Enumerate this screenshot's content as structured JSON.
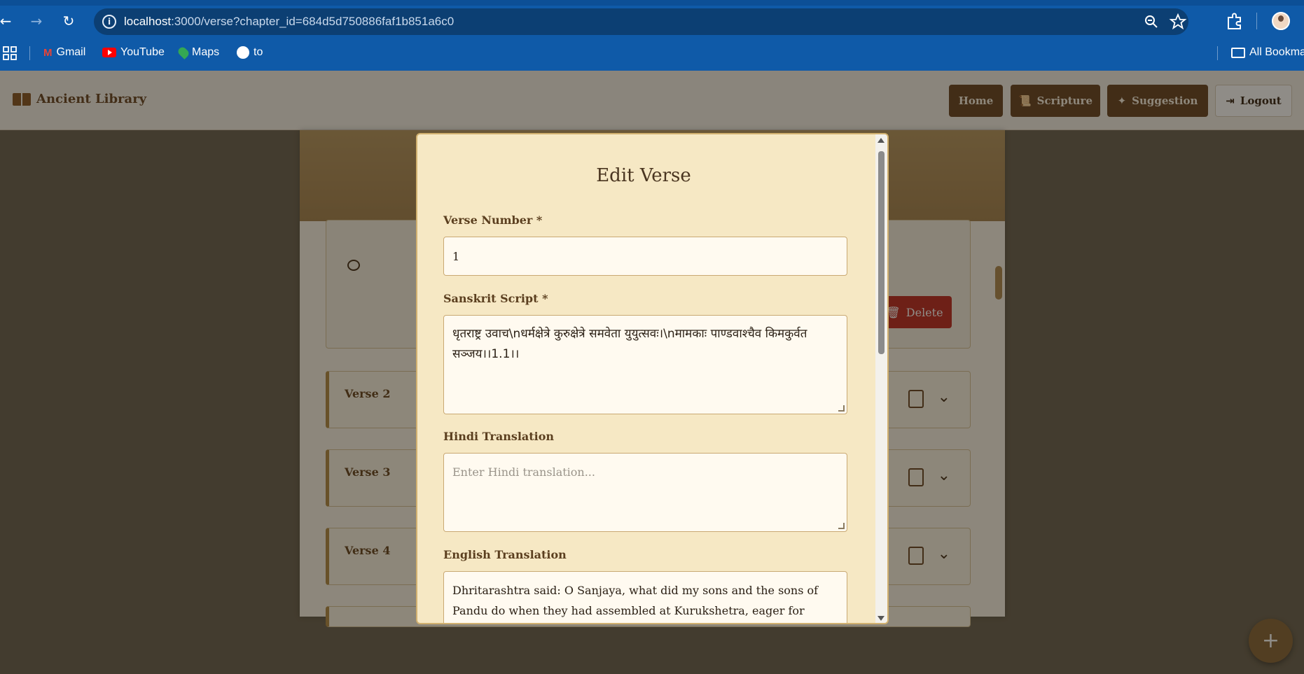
{
  "browser": {
    "url_host": "localhost",
    "url_rest": ":3000/verse?chapter_id=684d5d750886faf1b851a6c0",
    "bookmarks": [
      "Gmail",
      "YouTube",
      "Maps",
      "to"
    ],
    "all_bookmarks": "All Bookma"
  },
  "header": {
    "brand": "Ancient Library",
    "nav": {
      "home": "Home",
      "scripture": "Scripture",
      "suggestion": "Suggestion",
      "logout": "Logout"
    }
  },
  "page": {
    "verses": [
      "Verse 2",
      "Verse 3",
      "Verse 4"
    ],
    "delete_label": "Delete",
    "fab_symbol": "+"
  },
  "modal": {
    "title": "Edit Verse",
    "verse_number": {
      "label": "Verse Number *",
      "value": "1"
    },
    "sanskrit": {
      "label": "Sanskrit Script *",
      "value": "धृतराष्ट्र उवाच\\nधर्मक्षेत्रे कुरुक्षेत्रे समवेता युयुत्सवः।\\nमामकाः पाण्डवाश्चैव किमकुर्वत सञ्जय।।1.1।।"
    },
    "hindi": {
      "label": "Hindi Translation",
      "placeholder": "Enter Hindi translation..."
    },
    "english": {
      "label": "English Translation",
      "value": "Dhritarashtra said: O Sanjaya, what did my sons and the sons of Pandu do when they had assembled at Kurukshetra, eager for battle?"
    }
  },
  "colors": {
    "accent_brown": "#6b4a2a",
    "modal_bg": "#f6e8c4",
    "delete_red": "#c0302a"
  }
}
